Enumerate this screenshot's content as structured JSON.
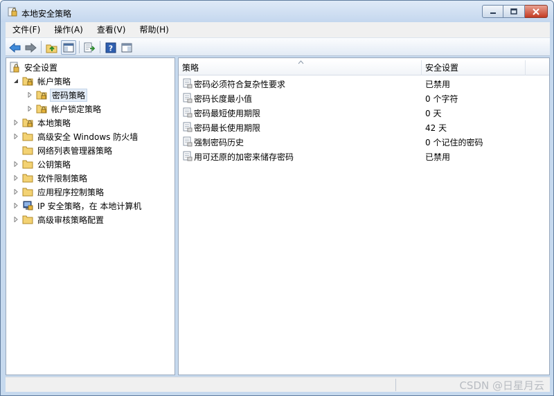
{
  "window": {
    "title": "本地安全策略",
    "buttons": {
      "minimize": "minimize",
      "maximize": "maximize",
      "close": "close"
    }
  },
  "menu": {
    "file": "文件(F)",
    "action": "操作(A)",
    "view": "查看(V)",
    "help": "帮助(H)"
  },
  "toolbar": {
    "icons": [
      "back-arrow-icon",
      "forward-arrow-icon",
      "up-folder-icon",
      "show-hide-tree-icon",
      "export-list-icon",
      "help-icon",
      "show-action-pane-icon"
    ]
  },
  "tree": {
    "root": "安全设置",
    "account_policies": "帐户策略",
    "password_policy": "密码策略",
    "account_lockout_policy": "帐户锁定策略",
    "local_policies": "本地策略",
    "firewall": "高级安全 Windows 防火墙",
    "network_list": "网络列表管理器策略",
    "public_key": "公钥策略",
    "software_restriction": "软件限制策略",
    "app_control": "应用程序控制策略",
    "ipsec": "IP 安全策略，在 本地计算机",
    "audit": "高级审核策略配置"
  },
  "list": {
    "col_policy": "策略",
    "col_setting": "安全设置",
    "rows": [
      {
        "name": "密码必须符合复杂性要求",
        "value": "已禁用"
      },
      {
        "name": "密码长度最小值",
        "value": "0 个字符"
      },
      {
        "name": "密码最短使用期限",
        "value": "0 天"
      },
      {
        "name": "密码最长使用期限",
        "value": "42 天"
      },
      {
        "name": "强制密码历史",
        "value": "0 个记住的密码"
      },
      {
        "name": "用可还原的加密来储存密码",
        "value": "已禁用"
      }
    ]
  },
  "status": {
    "watermark": "CSDN @日星月云"
  },
  "colors": {
    "frame": "#c6d9ee",
    "close_button": "#c43b22",
    "folder": "#f3d273",
    "selection": "#e4edf8"
  }
}
